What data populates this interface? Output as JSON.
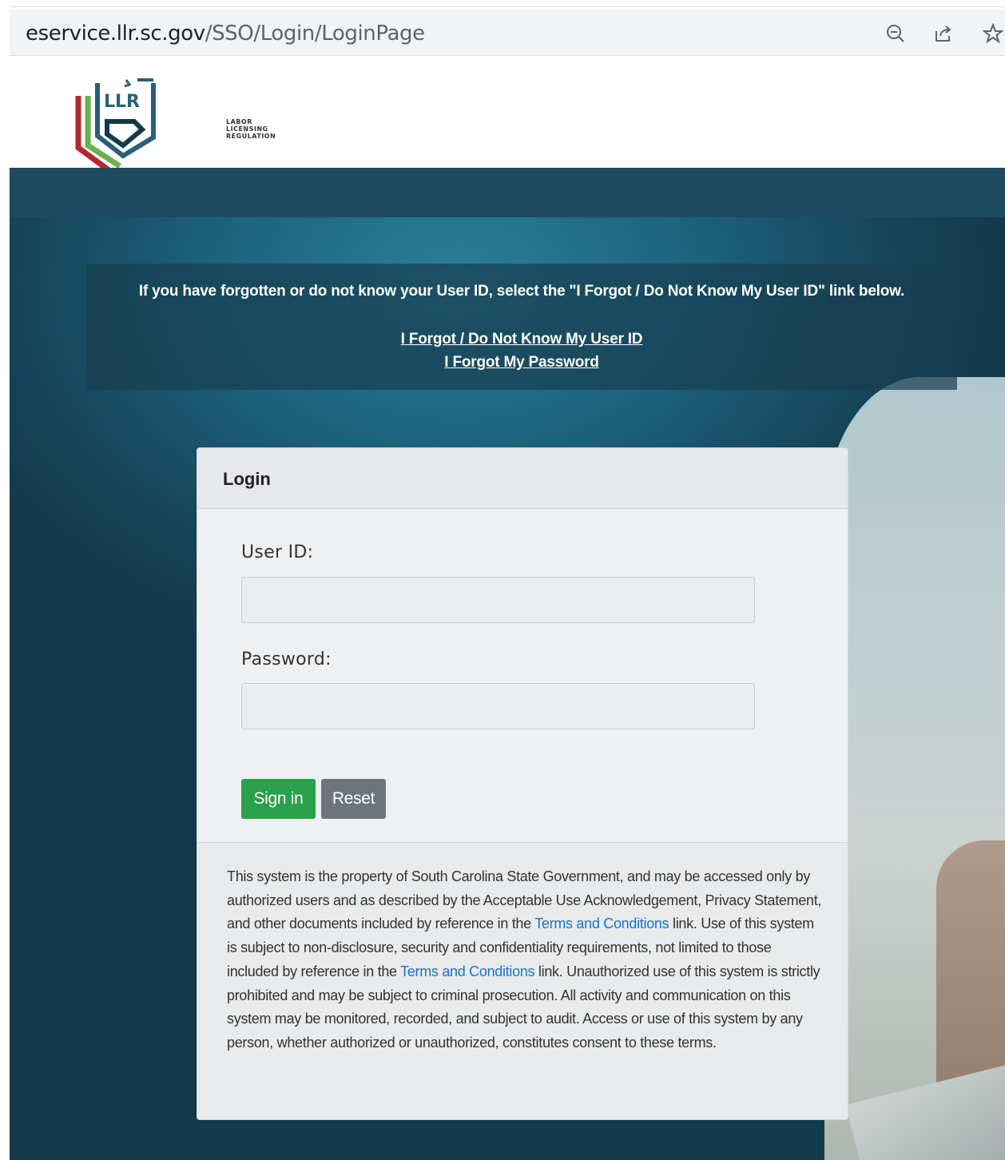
{
  "browser": {
    "url_host": "eservice.llr.sc.gov",
    "url_path": "/SSO/Login/LoginPage",
    "icons": [
      "zoom-out-icon",
      "share-icon",
      "bookmark-star-icon"
    ]
  },
  "header": {
    "logo_letters": "LLR",
    "logo_line1": "LABOR",
    "logo_line2": "LICENSING",
    "logo_line3": "REGULATION"
  },
  "notice": {
    "text": "If you have forgotten or do not know your User ID, select the \"I Forgot / Do Not Know My User ID\" link below.",
    "forgot_userid_link": "I Forgot / Do Not Know My User ID",
    "forgot_password_link": "I Forgot My Password"
  },
  "login": {
    "title": "Login",
    "userid_label": "User ID:",
    "userid_value": "",
    "password_label": "Password:",
    "password_value": "",
    "signin_label": "Sign in",
    "reset_label": "Reset"
  },
  "disclaimer": {
    "part1": "This system is the property of South Carolina State Government, and may be accessed only by authorized users and as described by the Acceptable Use Acknowledgement, Privacy Statement, and other documents included by reference in the ",
    "terms_link_1": "Terms and Conditions",
    "part2": " link. Use of this system is subject to non-disclosure, security and confidentiality requirements, not limited to those included by reference in the ",
    "terms_link_2": "Terms and Conditions",
    "part3": " link. Unauthorized use of this system is strictly prohibited and may be subject to criminal prosecution. All activity and communication on this system may be monitored, recorded, and subject to audit. Access or use of this system by any person, whether authorized or unauthorized, constitutes consent to these terms."
  },
  "colors": {
    "band": "#1e4a62",
    "signin": "#28a14a",
    "reset": "#6c757d",
    "link": "#1a73c8",
    "logo_red": "#b5262f",
    "logo_green": "#6ab04c",
    "logo_teal": "#2c5e74"
  }
}
